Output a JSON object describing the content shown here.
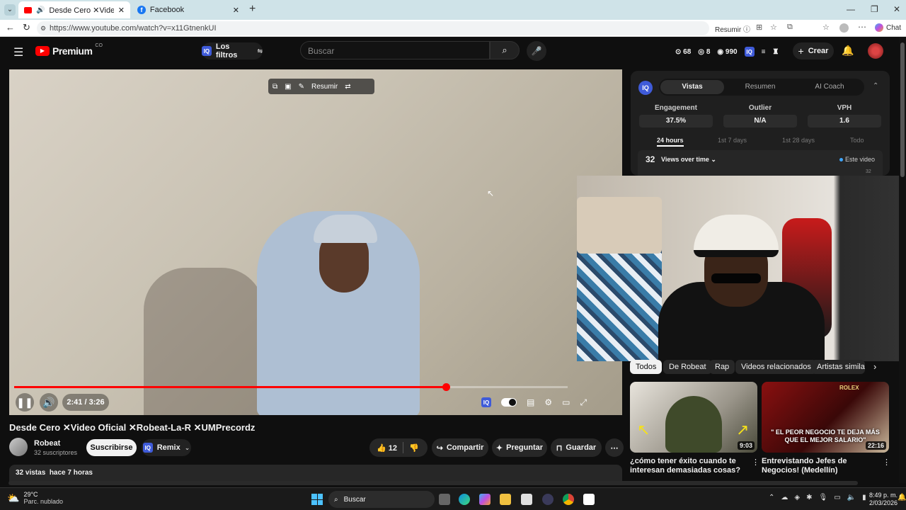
{
  "browser": {
    "tabs": [
      {
        "title": "Desde Cero ✕Video Oficial ✕",
        "active": true
      },
      {
        "title": "Facebook",
        "active": false
      }
    ],
    "url": "https://www.youtube.com/watch?v=x11GtnenkUI",
    "resumir_label": "Resumir",
    "chat_label": "Chat"
  },
  "header": {
    "logo": "Premium",
    "logo_sup": "CO",
    "filters_label": "Los filtros",
    "search_placeholder": "Buscar",
    "stats": {
      "a": "68",
      "b": "8",
      "c": "990"
    },
    "create_label": "Crear"
  },
  "player": {
    "overlay_resumir": "Resumir",
    "time": "2:41 / 3:26",
    "progress_fraction": 0.78
  },
  "video": {
    "title": "Desde Cero ✕Video Oficial ✕Robeat-La-R ✕UMPrecordz",
    "channel": "Robeat",
    "subscribers": "32 suscriptores",
    "subscribe_label": "Suscribirse",
    "remix_label": "Remix",
    "likes": "12",
    "share_label": "Compartir",
    "ask_label": "Preguntar",
    "save_label": "Guardar",
    "views_line": "32 vistas  hace 7 horas"
  },
  "iq_panel": {
    "tabs": [
      "Vistas",
      "Resumen",
      "AI Coach"
    ],
    "metrics": [
      {
        "label": "Engagement",
        "value": "37.5%"
      },
      {
        "label": "Outlier",
        "value": "N/A"
      },
      {
        "label": "VPH",
        "value": "1.6"
      }
    ],
    "periods": [
      "24 hours",
      "1st 7 days",
      "1st 28 days",
      "Todo"
    ],
    "views_count": "32",
    "views_dropdown": "Views over time",
    "legend": "Este video",
    "axis_tick": "32"
  },
  "chips": [
    "Todos",
    "De Robeat",
    "Rap",
    "Videos relacionados",
    "Artistas similare"
  ],
  "recommended": [
    {
      "title": "¿cómo tener éxito cuando te interesan demasiadas cosas?",
      "duration": "9:03"
    },
    {
      "title": "Entrevistando Jefes de Negocios! (Medellín)",
      "duration": "22:16",
      "caption": "\" EL PEOR NEGOCIO TE DEJA MÁS QUE EL MEJOR SALARIO\"",
      "sign": "ROLEX"
    }
  ],
  "taskbar": {
    "weather_temp": "29°C",
    "weather_desc": "Parc. nublado",
    "search_label": "Buscar",
    "time": "8:49 p. m.",
    "date": "2/03/2026"
  }
}
